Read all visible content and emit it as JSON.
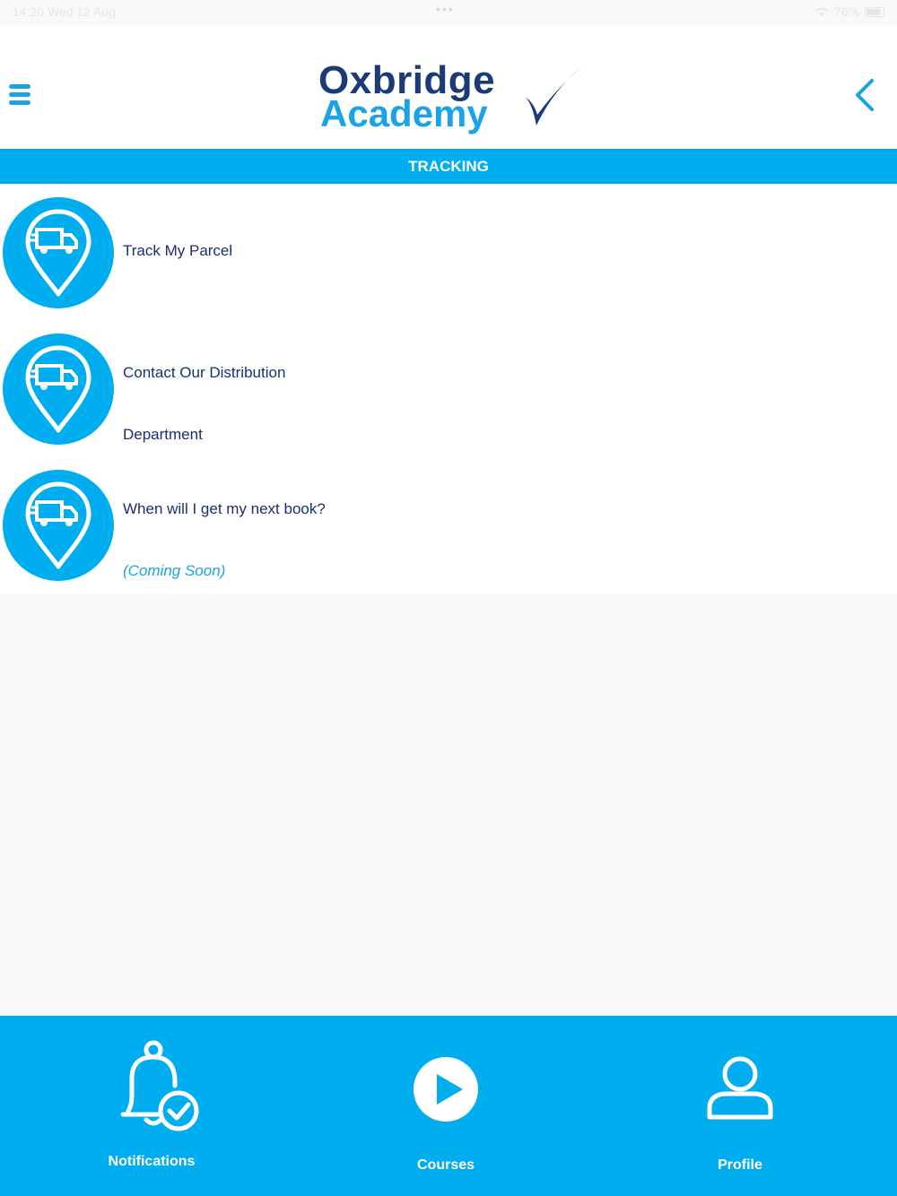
{
  "status_bar": {
    "left": "14:20   Wed 12 Aug",
    "right": "76%",
    "dots": "•••"
  },
  "header": {
    "logo_line1": "Oxbridge",
    "logo_line2": "Academy"
  },
  "section": {
    "title": "TRACKING"
  },
  "items": [
    {
      "label": "Track My Parcel",
      "icon": "delivery-truck-pin-icon"
    },
    {
      "label": "Contact Our Distribution",
      "label_line2": "Department",
      "icon": "delivery-truck-pin-icon"
    },
    {
      "label": "When will I get my next book?",
      "note": "(Coming Soon)",
      "icon": "delivery-truck-pin-icon"
    }
  ],
  "tabbar": {
    "notifications": "Notifications",
    "courses": "Courses",
    "profile": "Profile"
  },
  "colors": {
    "accent": "#00aeef",
    "navy": "#1b3a78",
    "text": "#1b2f6e"
  }
}
